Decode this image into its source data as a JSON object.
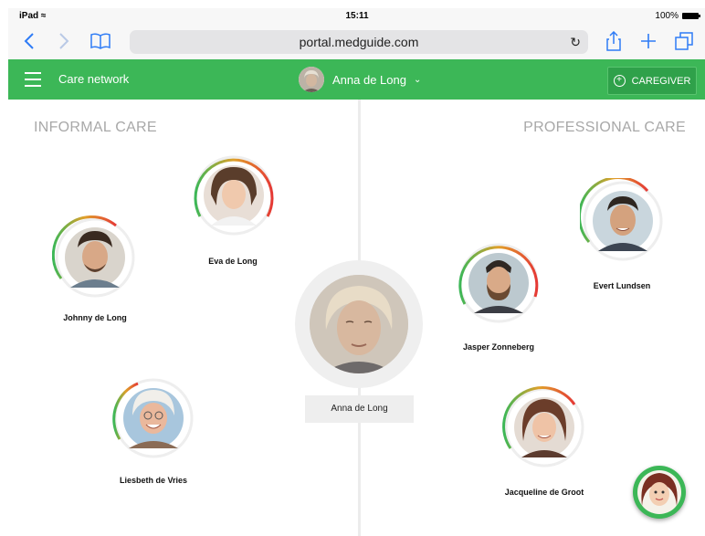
{
  "status_bar": {
    "device": "iPad",
    "time": "15:11",
    "battery": "100%"
  },
  "browser": {
    "url": "portal.medguide.com"
  },
  "header": {
    "title": "Care network",
    "patient_name": "Anna de Long",
    "caregiver_button": "CAREGIVER"
  },
  "sections": {
    "informal": "INFORMAL CARE",
    "professional": "PROFESSIONAL CARE"
  },
  "center_person": {
    "name": "Anna de Long"
  },
  "people": [
    {
      "name": "Eva de Long",
      "side": "informal"
    },
    {
      "name": "Johnny de Long",
      "side": "informal"
    },
    {
      "name": "Liesbeth de Vries",
      "side": "informal"
    },
    {
      "name": "Evert Lundsen",
      "side": "professional"
    },
    {
      "name": "Jasper Zonneberg",
      "side": "professional"
    },
    {
      "name": "Jacqueline de Groot",
      "side": "professional"
    }
  ],
  "colors": {
    "accent": "#3cb757",
    "ring_start": "#3cb757",
    "ring_end": "#e53935"
  }
}
